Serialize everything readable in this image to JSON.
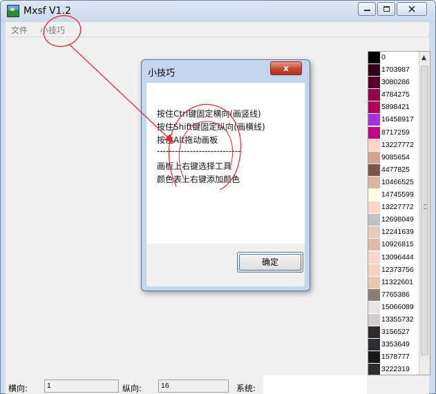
{
  "window": {
    "title": "Mxsf V1.2"
  },
  "menu": {
    "file": "文件",
    "tips": "小技巧"
  },
  "dialog": {
    "title": "小技巧",
    "close_glyph": "x",
    "lines": [
      "按住Ctrl键固定横向(画竖线)",
      "按住Shift键固定纵向(画横线)",
      "按住Alt拖动画板",
      "----------------------------",
      "画板上右键选择工具",
      "颜色表上右键添加颜色"
    ],
    "ok_label": "确定"
  },
  "palette": [
    {
      "value": "0",
      "color": "#000000"
    },
    {
      "value": "1703987",
      "color": "#33001a"
    },
    {
      "value": "3080286",
      "color": "#5e002f"
    },
    {
      "value": "4784275",
      "color": "#930049"
    },
    {
      "value": "5898421",
      "color": "#b50059"
    },
    {
      "value": "16458917",
      "color": "#a52fe3"
    },
    {
      "value": "8717259",
      "color": "#cb0085"
    },
    {
      "value": "13227772",
      "color": "#fcd5c9"
    },
    {
      "value": "9085654",
      "color": "#d6a28a"
    },
    {
      "value": "4477825",
      "color": "#815344"
    },
    {
      "value": "10466525",
      "color": "#ddb59f"
    },
    {
      "value": "14745599",
      "color": "#fffee0"
    },
    {
      "value": "13227772",
      "color": "#fcd5c9"
    },
    {
      "value": "12698049",
      "color": "#c1c1c1"
    },
    {
      "value": "12241639",
      "color": "#e7cabb"
    },
    {
      "value": "10926815",
      "color": "#dfbba6"
    },
    {
      "value": "13096444",
      "color": "#fcd5c7"
    },
    {
      "value": "12373756",
      "color": "#fccebc"
    },
    {
      "value": "11322601",
      "color": "#e9c5ac"
    },
    {
      "value": "7765386",
      "color": "#8a7d76"
    },
    {
      "value": "15066089",
      "color": "#e9e4e5"
    },
    {
      "value": "13355732",
      "color": "#d4cacb"
    },
    {
      "value": "3156527",
      "color": "#2f2a30"
    },
    {
      "value": "3353649",
      "color": "#312c33"
    },
    {
      "value": "1578777",
      "color": "#191718"
    },
    {
      "value": "3222319",
      "color": "#2f2b31"
    }
  ],
  "status": {
    "h_label": "横向:",
    "h_value": "1",
    "v_label": "纵向:",
    "v_value": "16",
    "sys_label": "系统:"
  },
  "colors": {
    "annotation": "#e8262c",
    "titlebar": "#cfdcec"
  }
}
